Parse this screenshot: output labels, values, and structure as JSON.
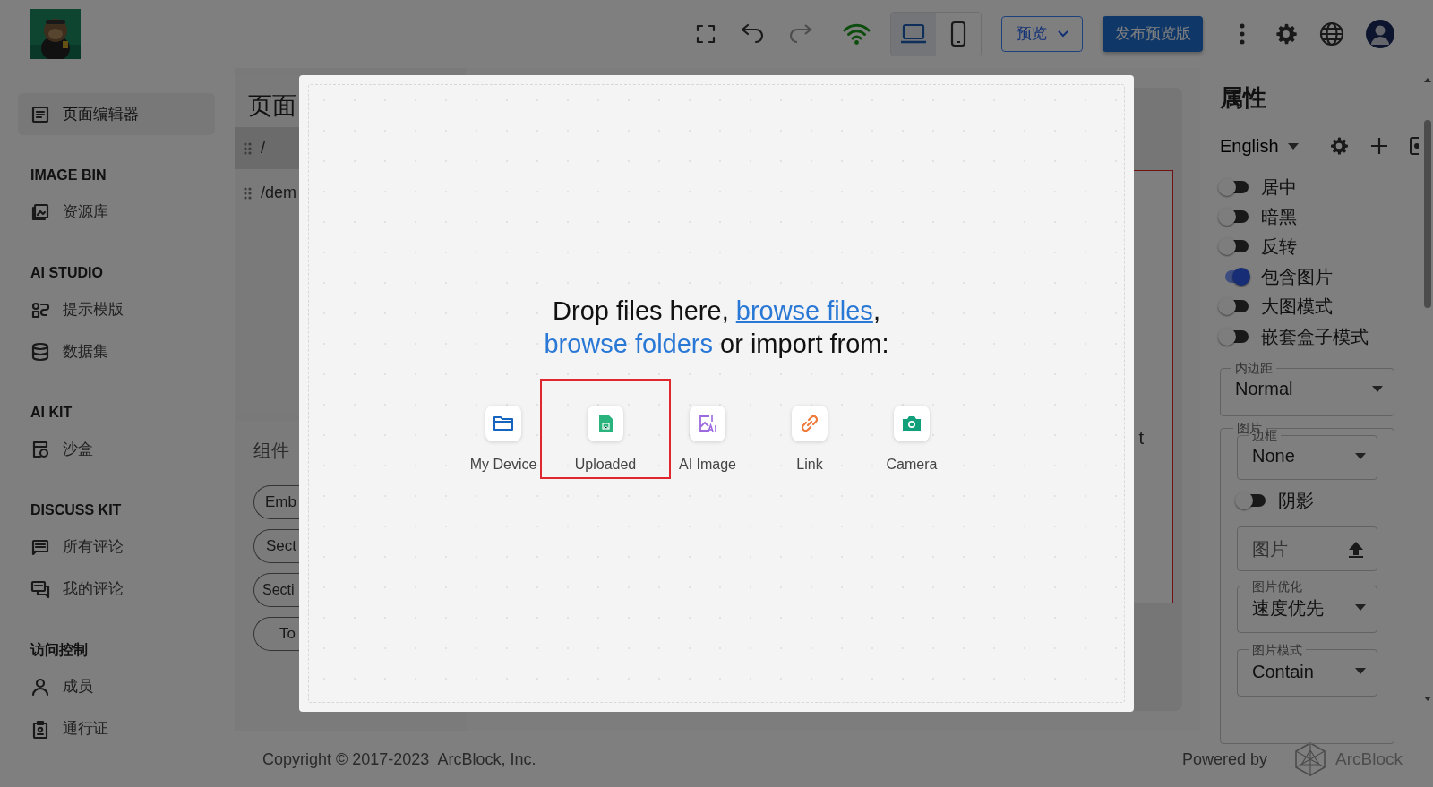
{
  "header": {
    "device_modes": [
      {
        "selected": true
      },
      {
        "selected": false
      }
    ],
    "preview_select": "预览",
    "publish_button": "发布预览版"
  },
  "sidebar": {
    "entries": [
      {
        "kind": "item",
        "label": "页面编辑器",
        "selected": true
      },
      {
        "kind": "heading",
        "label": "IMAGE BIN"
      },
      {
        "kind": "item",
        "label": "资源库",
        "selected": false
      },
      {
        "kind": "heading",
        "label": "AI STUDIO"
      },
      {
        "kind": "item",
        "label": "提示模版",
        "selected": false
      },
      {
        "kind": "item",
        "label": "数据集",
        "selected": false
      },
      {
        "kind": "heading",
        "label": "AI KIT"
      },
      {
        "kind": "item",
        "label": "沙盒",
        "selected": false
      },
      {
        "kind": "heading",
        "label": "DISCUSS KIT"
      },
      {
        "kind": "item",
        "label": "所有评论",
        "selected": false
      },
      {
        "kind": "item",
        "label": "我的评论",
        "selected": false
      },
      {
        "kind": "heading",
        "label": "访问控制"
      },
      {
        "kind": "item",
        "label": "成员",
        "selected": false
      },
      {
        "kind": "item",
        "label": "通行证",
        "selected": false
      }
    ]
  },
  "pages": {
    "title": "页面",
    "items": [
      {
        "path": "/",
        "selected": true
      },
      {
        "path": "/dem",
        "selected": false
      }
    ]
  },
  "components": {
    "title": "组件",
    "chips": [
      "Emb",
      "Sect",
      "Secti",
      "To"
    ]
  },
  "canvas": {
    "text": "t"
  },
  "properties": {
    "title": "属性",
    "language": "English",
    "toggles": [
      {
        "label": "居中",
        "on": false
      },
      {
        "label": "暗黑",
        "on": false
      },
      {
        "label": "反转",
        "on": false
      },
      {
        "label": "包含图片",
        "on": true
      },
      {
        "label": "大图模式",
        "on": false
      },
      {
        "label": "嵌套盒子模式",
        "on": false
      }
    ],
    "padding": {
      "label": "内边距",
      "value": "Normal"
    },
    "image_group": {
      "legend": "图片",
      "border": {
        "label": "边框",
        "value": "None"
      },
      "shadow": {
        "label": "阴影",
        "on": false
      },
      "upload": {
        "label": "图片"
      },
      "optimize": {
        "label": "图片优化",
        "value": "速度优先"
      },
      "mode": {
        "label": "图片模式",
        "value": "Contain"
      }
    }
  },
  "footer": {
    "copyright": "Copyright © 2017-2023  ArcBlock, Inc.",
    "powered_by": "Powered by",
    "brand": "ArcBlock"
  },
  "upload_dialog": {
    "prompt": [
      {
        "kind": "text",
        "text": "Drop files here, "
      },
      {
        "kind": "link",
        "text": "browse files"
      },
      {
        "kind": "text",
        "text": ", "
      },
      {
        "kind": "link",
        "text": "browse folders"
      },
      {
        "kind": "text",
        "text": " or import from:"
      }
    ],
    "sources": [
      {
        "label": "My Device",
        "selected": false
      },
      {
        "label": "Uploaded",
        "selected": true
      },
      {
        "label": "AI Image",
        "selected": false
      },
      {
        "label": "Link",
        "selected": false
      },
      {
        "label": "Camera",
        "selected": false
      }
    ]
  }
}
